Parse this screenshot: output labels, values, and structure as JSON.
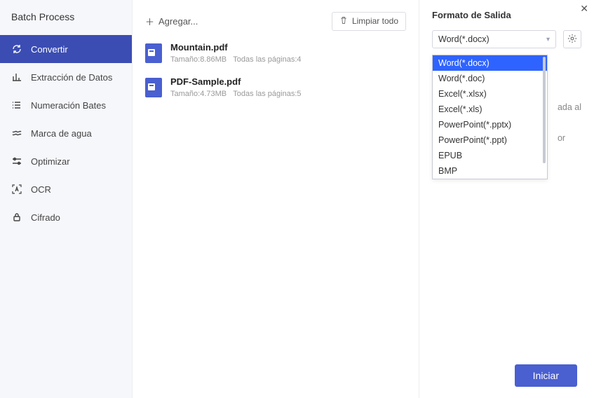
{
  "window": {
    "title": "Batch Process"
  },
  "sidebar": {
    "items": [
      {
        "label": "Convertir"
      },
      {
        "label": "Extracción de Datos"
      },
      {
        "label": "Numeración Bates"
      },
      {
        "label": "Marca de agua"
      },
      {
        "label": "Optimizar"
      },
      {
        "label": "OCR"
      },
      {
        "label": "Cifrado"
      }
    ]
  },
  "toolbar": {
    "add_label": "Agregar...",
    "clear_label": "Limpiar todo"
  },
  "files": [
    {
      "name": "Mountain.pdf",
      "size": "Tamaño:8.86MB",
      "pages": "Todas las páginas:4"
    },
    {
      "name": "PDF-Sample.pdf",
      "size": "Tamaño:4.73MB",
      "pages": "Todas las páginas:5"
    }
  ],
  "output": {
    "title": "Formato de Salida",
    "selected": "Word(*.docx)",
    "options": [
      "Word(*.docx)",
      "Word(*.doc)",
      "Excel(*.xlsx)",
      "Excel(*.xls)",
      "PowerPoint(*.pptx)",
      "PowerPoint(*.ppt)",
      "EPUB",
      "BMP"
    ],
    "hidden_hint_1": "ada al",
    "hidden_hint_2": "or"
  },
  "footer": {
    "start_label": "Iniciar"
  }
}
